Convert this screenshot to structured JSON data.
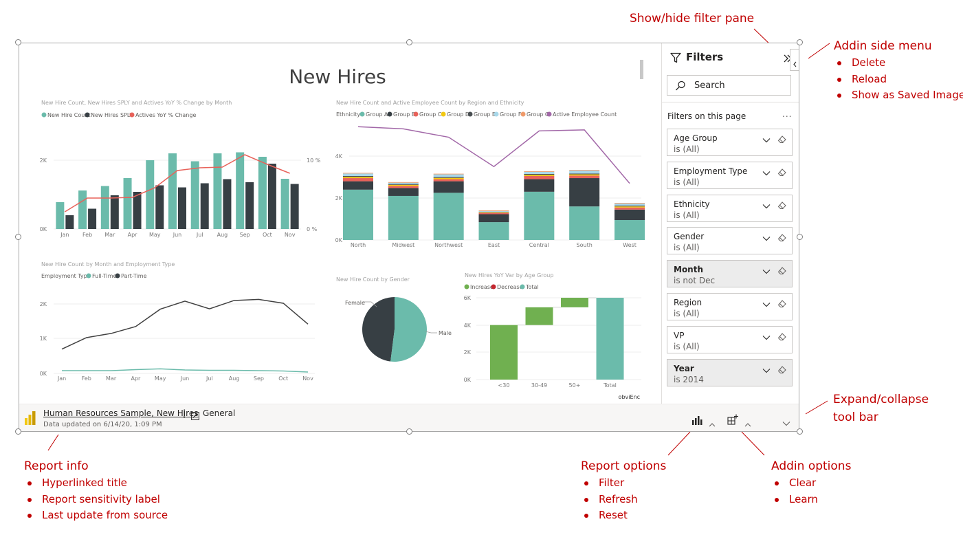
{
  "annotations": {
    "filter_pane": {
      "heading": "Show/hide filter pane"
    },
    "side_menu": {
      "heading": "Addin side menu",
      "items": [
        "Delete",
        "Reload",
        "Show as Saved Image"
      ]
    },
    "toolbar": {
      "heading_line1": "Expand/collapse",
      "heading_line2": "tool bar"
    },
    "report_info": {
      "heading": "Report info",
      "items": [
        "Hyperlinked title",
        "Report sensitivity label",
        "Last update from source"
      ]
    },
    "report_options": {
      "heading": "Report options",
      "items": [
        "Filter",
        "Refresh",
        "Reset"
      ]
    },
    "addin_options": {
      "heading": "Addin options",
      "items": [
        "Clear",
        "Learn"
      ]
    }
  },
  "report": {
    "page_title": "New Hires",
    "hyperlinked_title": "Human Resources Sample, New Hires",
    "separator": "|",
    "sensitivity_label": "General",
    "last_updated": "Data updated on 6/14/20, 1:09 PM",
    "watermark": "obviEnc"
  },
  "filters": {
    "title": "Filters",
    "search_placeholder": "Search",
    "section_label": "Filters on this page",
    "more": "...",
    "items": [
      {
        "name": "Age Group",
        "value": "is (All)",
        "active": false
      },
      {
        "name": "Employment Type",
        "value": "is (All)",
        "active": false
      },
      {
        "name": "Ethnicity",
        "value": "is (All)",
        "active": false
      },
      {
        "name": "Gender",
        "value": "is (All)",
        "active": false
      },
      {
        "name": "Month",
        "value": "is not Dec",
        "active": true
      },
      {
        "name": "Region",
        "value": "is (All)",
        "active": false
      },
      {
        "name": "VP",
        "value": "is (All)",
        "active": false
      },
      {
        "name": "Year",
        "value": "is 2014",
        "active": true
      }
    ]
  },
  "colors": {
    "teal": "#6bbbab",
    "dark": "#373f44",
    "red": "#e8625a",
    "purple": "#a268a8",
    "green": "#70b050",
    "annotation": "#c00000",
    "powerbi_yellow": "#f2c811"
  },
  "icons": {
    "filter": "funnel-icon",
    "expand": "double-chevron-right-icon",
    "side_menu": "chevron-left-icon",
    "search": "magnifier-icon",
    "report_options": "bar-chart-icon",
    "addin_options": "grid-plus-icon",
    "toolbar": "chevron-down-icon",
    "logo": "powerbi-logo-icon",
    "label": "sensitivity-label-icon"
  },
  "chart_data": [
    {
      "type": "bar",
      "title": "New Hire Count, New Hires SPLY and Actives YoY % Change by Month",
      "legend": [
        "New Hire Count",
        "New Hires SPLY",
        "Actives YoY % Change"
      ],
      "categories": [
        "Jan",
        "Feb",
        "Mar",
        "Apr",
        "May",
        "Jun",
        "Jul",
        "Aug",
        "Sep",
        "Oct",
        "Nov"
      ],
      "y_ticks": [
        "2K",
        "0K"
      ],
      "y2_ticks": [
        "10 %",
        "0 %"
      ],
      "ylim": [
        0,
        2000
      ],
      "y2lim": [
        0,
        10
      ],
      "series": [
        {
          "name": "New Hire Count",
          "type": "bar",
          "values": [
            780,
            1120,
            1250,
            1480,
            2000,
            2200,
            1970,
            2200,
            2230,
            2100,
            1460
          ]
        },
        {
          "name": "New Hires SPLY",
          "type": "bar",
          "values": [
            400,
            590,
            980,
            1080,
            1270,
            1210,
            1330,
            1450,
            1360,
            1900,
            1310
          ]
        },
        {
          "name": "Actives YoY % Change",
          "type": "line",
          "axis": "y2",
          "values": [
            2.5,
            4.5,
            4.5,
            4.6,
            6.0,
            8.5,
            8.9,
            9.0,
            10.8,
            9.4,
            8.1
          ]
        }
      ]
    },
    {
      "type": "bar",
      "title": "New Hire Count and Active Employee Count by Region and Ethnicity",
      "legend_title": "Ethnicity",
      "legend": [
        "Group A",
        "Group B",
        "Group C",
        "Group D",
        "Group E",
        "Group F",
        "Group G",
        "Active Employee Count"
      ],
      "categories": [
        "North",
        "Midwest",
        "Northwest",
        "East",
        "Central",
        "South",
        "West"
      ],
      "y_ticks": [
        "4K",
        "2K",
        "0K"
      ],
      "ylim": [
        0,
        6000
      ],
      "series": [
        {
          "name": "Group A",
          "values": [
            2400,
            2100,
            2250,
            850,
            2300,
            1600,
            950
          ]
        },
        {
          "name": "Group B",
          "values": [
            400,
            380,
            550,
            380,
            600,
            1350,
            500
          ]
        },
        {
          "name": "Group C",
          "values": [
            150,
            100,
            100,
            60,
            150,
            120,
            100
          ]
        },
        {
          "name": "Group D",
          "values": [
            60,
            50,
            60,
            30,
            60,
            60,
            50
          ]
        },
        {
          "name": "Group E",
          "values": [
            40,
            40,
            40,
            20,
            40,
            40,
            40
          ]
        },
        {
          "name": "Group F",
          "values": [
            120,
            60,
            130,
            40,
            100,
            140,
            100
          ]
        },
        {
          "name": "Group G",
          "values": [
            30,
            30,
            30,
            30,
            30,
            30,
            30
          ]
        },
        {
          "name": "Active Employee Count",
          "type": "line",
          "values": [
            5400,
            5300,
            4900,
            3500,
            5200,
            5250,
            2700
          ]
        }
      ]
    },
    {
      "type": "line",
      "title": "New Hire Count by Month and Employment Type",
      "legend_title": "Employment Type",
      "legend": [
        "Full-Time",
        "Part-Time"
      ],
      "categories": [
        "Jan",
        "Feb",
        "Mar",
        "Apr",
        "May",
        "Jun",
        "Jul",
        "Aug",
        "Sep",
        "Oct",
        "Nov"
      ],
      "y_ticks": [
        "2K",
        "1K",
        "0K"
      ],
      "ylim": [
        0,
        2200
      ],
      "series": [
        {
          "name": "Full-Time",
          "values": [
            80,
            80,
            80,
            110,
            130,
            100,
            90,
            90,
            80,
            70,
            40
          ]
        },
        {
          "name": "Part-Time",
          "values": [
            700,
            1030,
            1150,
            1350,
            1850,
            2080,
            1860,
            2100,
            2130,
            2020,
            1420
          ]
        }
      ]
    },
    {
      "type": "pie",
      "title": "New Hire Count by Gender",
      "categories": [
        "Female",
        "Male"
      ],
      "values": [
        48,
        52
      ]
    },
    {
      "type": "bar",
      "subtype": "waterfall",
      "title": "New Hires YoY Var by Age Group",
      "legend": [
        "Increase",
        "Decrease",
        "Total"
      ],
      "categories": [
        "<30",
        "30-49",
        "50+",
        "Total"
      ],
      "y_ticks": [
        "6K",
        "4K",
        "2K",
        "0K"
      ],
      "ylim": [
        0,
        6000
      ],
      "values": [
        4000,
        1300,
        700,
        6000
      ]
    }
  ]
}
